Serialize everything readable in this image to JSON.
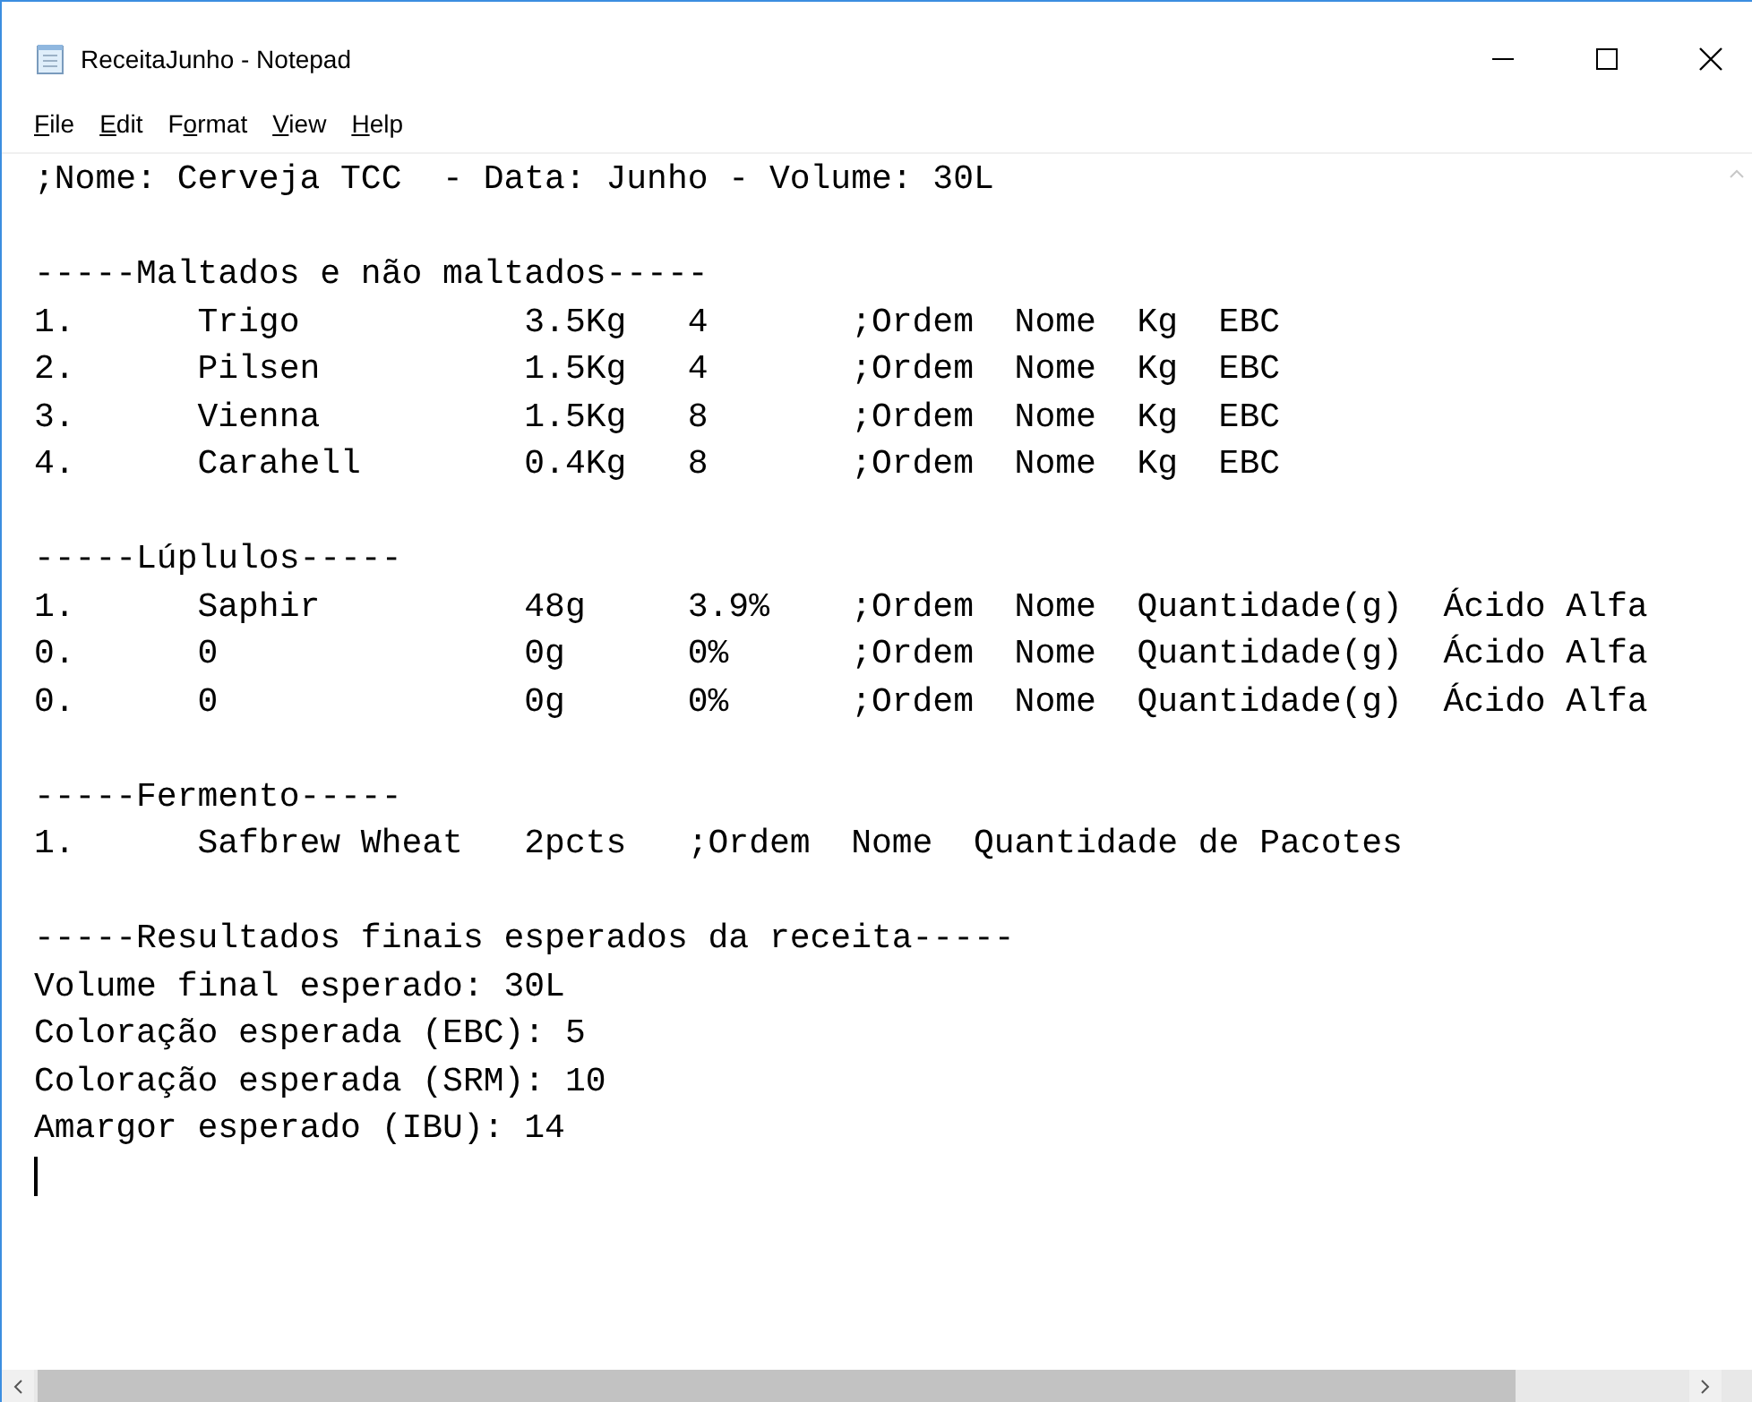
{
  "window": {
    "title": "ReceitaJunho - Notepad"
  },
  "menu": [
    {
      "key": "F",
      "after": "ile"
    },
    {
      "key": "E",
      "after": "dit"
    },
    {
      "before": "F",
      "key": "o",
      "after": "rmat"
    },
    {
      "key": "V",
      "after": "iew"
    },
    {
      "key": "H",
      "after": "elp"
    }
  ],
  "lines": [
    {
      "kind": "text",
      "text": ";Nome: Cerveja TCC  - Data: Junho - Volume: 30L"
    },
    {
      "kind": "blank"
    },
    {
      "kind": "text",
      "text": "-----Maltados e não maltados-----"
    },
    {
      "kind": "text",
      "text": "1.\tTrigo\t\t3.5Kg\t4\t;Ordem  Nome  Kg  EBC"
    },
    {
      "kind": "text",
      "text": "2.\tPilsen\t\t1.5Kg\t4\t;Ordem  Nome  Kg  EBC"
    },
    {
      "kind": "text",
      "text": "3.\tVienna\t\t1.5Kg\t8\t;Ordem  Nome  Kg  EBC"
    },
    {
      "kind": "text",
      "text": "4.\tCarahell\t0.4Kg\t8\t;Ordem  Nome  Kg  EBC"
    },
    {
      "kind": "blank"
    },
    {
      "kind": "text",
      "text": "-----Lúplulos-----"
    },
    {
      "kind": "text",
      "text": "1.\tSaphir\t\t48g\t3.9%\t;Ordem  Nome  Quantidade(g)  Ácido Alfa"
    },
    {
      "kind": "text",
      "text": "0.\t0\t\t0g\t0%\t;Ordem  Nome  Quantidade(g)  Ácido Alfa"
    },
    {
      "kind": "text",
      "text": "0.\t0\t\t0g\t0%\t;Ordem  Nome  Quantidade(g)  Ácido Alfa"
    },
    {
      "kind": "blank"
    },
    {
      "kind": "text",
      "text": "-----Fermento-----"
    },
    {
      "kind": "text",
      "text": "1.\tSafbrew Wheat\t2pcts\t;Ordem  Nome  Quantidade de Pacotes"
    },
    {
      "kind": "blank"
    },
    {
      "kind": "text",
      "text": "-----Resultados finais esperados da receita-----"
    },
    {
      "kind": "text",
      "text": "Volume final esperado: 30L"
    },
    {
      "kind": "text",
      "text": "Coloração esperada (EBC): 5"
    },
    {
      "kind": "text",
      "text": "Coloração esperada (SRM): 10"
    },
    {
      "kind": "text",
      "text": "Amargor esperado (IBU): 14"
    },
    {
      "kind": "caret"
    }
  ]
}
